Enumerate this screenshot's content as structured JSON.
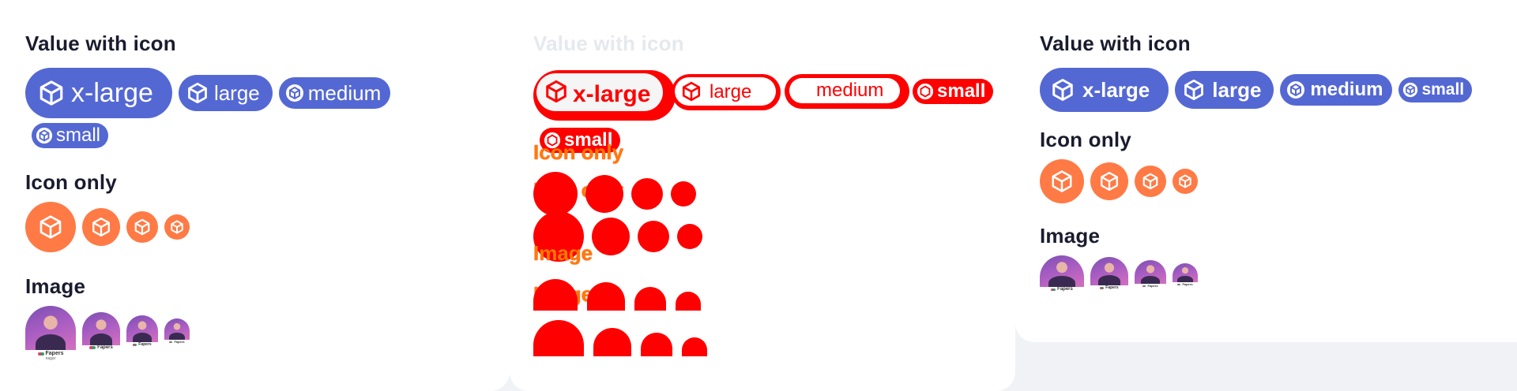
{
  "colors": {
    "pill": "#5468d4",
    "icon_only": "#ff7a45",
    "error": "#ff0000",
    "panel": "#ffffff",
    "page": "#f1f2f5"
  },
  "sections": {
    "value_with_icon": "Value with icon",
    "icon_only": "Icon only",
    "image": "Image"
  },
  "sizes": [
    "x-large",
    "large",
    "medium",
    "small"
  ],
  "icon_name": "box-icon",
  "avatar_brand": "Fapers",
  "avatar_sub": "nagar"
}
